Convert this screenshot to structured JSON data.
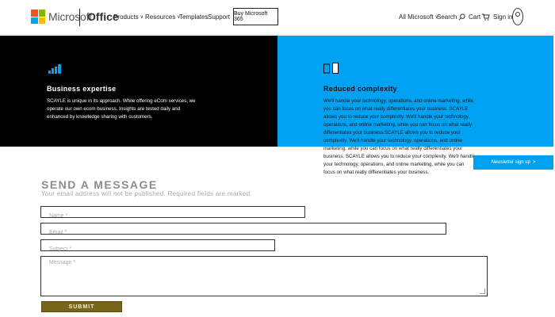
{
  "header": {
    "brand": "Microsoft",
    "product": "Office",
    "nav": [
      {
        "label": "Products",
        "dropdown": true
      },
      {
        "label": "Resources",
        "dropdown": true
      },
      {
        "label": "Templates",
        "dropdown": false
      },
      {
        "label": "Support",
        "dropdown": false
      }
    ],
    "buy_button": "Buy Microsoft 365",
    "all_microsoft": "All Microsoft",
    "search": "Search",
    "cart": "Cart",
    "signin": "Sign in",
    "logo_colors": [
      "#f25022",
      "#7fba00",
      "#00a4ef",
      "#ffb900"
    ]
  },
  "panels": {
    "left": {
      "icon": "bar-chart-icon",
      "title": "Business expertise",
      "lines": [
        "SCAYLE is unique in its approach. While offering eCom services, we",
        "operate our own ecom business. Insights are tested daily and",
        "enhanced by knowledge sharing with customers."
      ],
      "background": "#000000"
    },
    "right": {
      "icon": "document-icon",
      "title": "Reduced complexity",
      "lines": [
        "We'll handle your technology, operations, and online marketing, while",
        "you can focus on what really differentiates your business. SCAYLE",
        "allows you to reduce your complexity. We'll handle your technology,",
        "operations, and online marketing, while you can focus on what really",
        "differentiates your business.SCAYLE allows you to reduce your",
        "complexity. We'll handle your technology, operations, and online",
        "marketing, while you can focus on what really differentiates your",
        "business. SCAYLE allows you to reduce your complexity. We'll handle",
        "your technology, operations, and online marketing, while you can",
        "focus on what really differentiates your business."
      ],
      "background": "#00a1f1"
    }
  },
  "newsletter": {
    "label": "Newsletter sign up",
    "arrow": ">"
  },
  "form": {
    "title": "SEND A MESSAGE",
    "subtitle": "Your email address will not be published. Required fields are marked.",
    "name_placeholder": "Name *",
    "email_placeholder": "Email *",
    "subject_placeholder": "Subject *",
    "message_placeholder": "Message *",
    "submit_label": "SUBMIT"
  }
}
